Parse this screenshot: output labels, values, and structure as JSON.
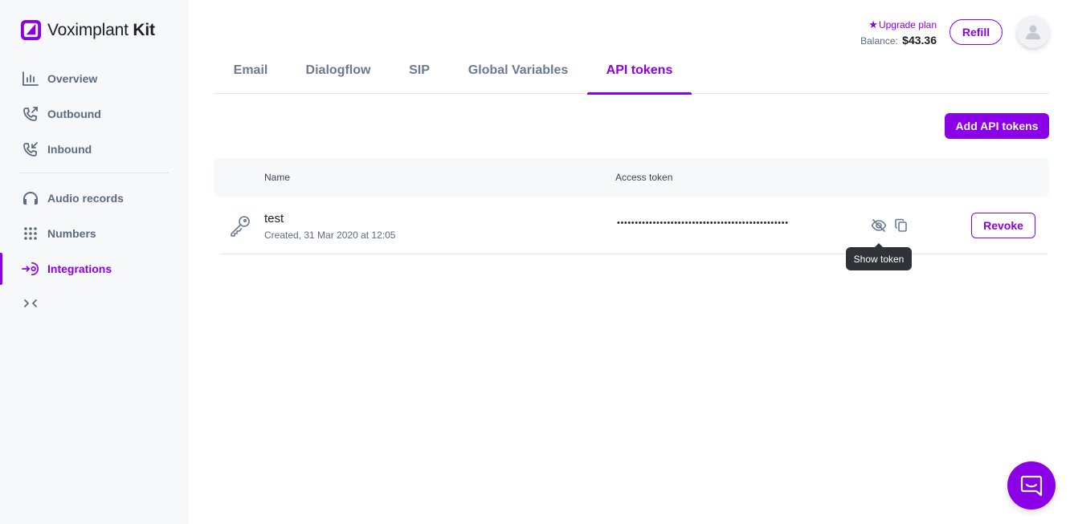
{
  "brand": {
    "name_regular": "Voximplant",
    "name_bold": "Kit",
    "accent_color": "#8b00e6"
  },
  "sidebar": {
    "items": [
      {
        "label": "Overview",
        "icon": "overview-icon"
      },
      {
        "label": "Outbound",
        "icon": "outbound-call-icon"
      },
      {
        "label": "Inbound",
        "icon": "inbound-call-icon"
      },
      {
        "label": "Audio records",
        "icon": "headphones-icon"
      },
      {
        "label": "Numbers",
        "icon": "dialpad-icon"
      },
      {
        "label": "Integrations",
        "icon": "integrations-icon",
        "active": true
      }
    ],
    "collapse_label": "><"
  },
  "header": {
    "upgrade_label": "Upgrade plan",
    "balance_label": "Balance:",
    "balance_amount": "$43.36",
    "refill_label": "Refill"
  },
  "tabs": [
    {
      "label": "Email"
    },
    {
      "label": "Dialogflow"
    },
    {
      "label": "SIP"
    },
    {
      "label": "Global Variables"
    },
    {
      "label": "API tokens",
      "active": true
    }
  ],
  "add_button_label": "Add API tokens",
  "table": {
    "columns": [
      "Name",
      "Access token"
    ],
    "rows": [
      {
        "name": "test",
        "created": "Created, 31 Mar 2020 at 12:05",
        "token_mask": "••••••••••••••••••••••••••••••••••••••••••••••••",
        "revoke_label": "Revoke"
      }
    ]
  },
  "tooltip": "Show token"
}
